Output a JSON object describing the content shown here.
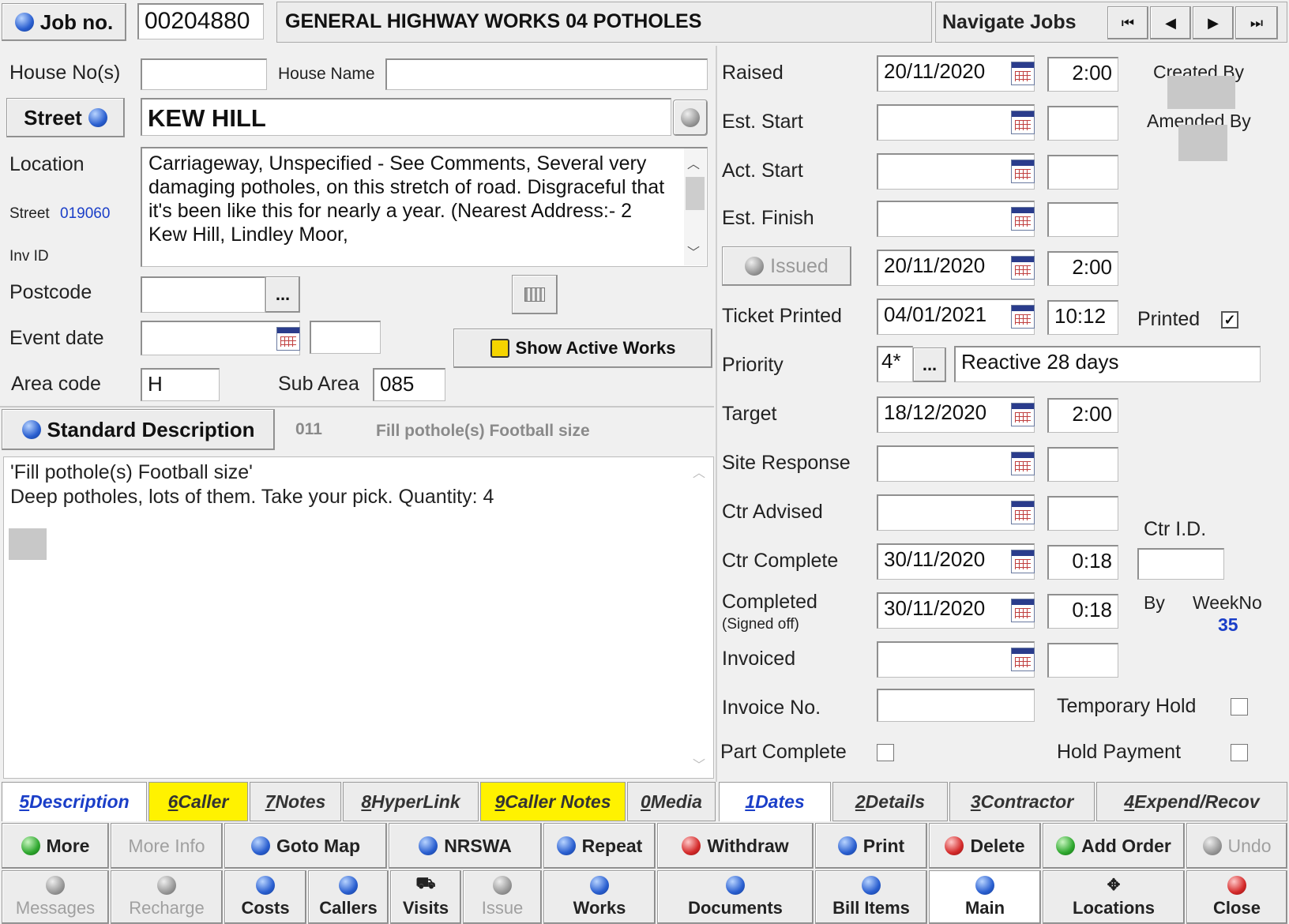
{
  "header": {
    "job_no_label": "Job no.",
    "job_no": "00204880",
    "job_title": "GENERAL HIGHWAY WORKS  04 POTHOLES",
    "navigate_label": "Navigate Jobs",
    "nav_first": "⏮",
    "nav_prev": "◀",
    "nav_next": "▶",
    "nav_last": "⏭"
  },
  "address": {
    "house_no_label": "House No(s)",
    "house_no": "",
    "house_name_label": "House Name",
    "house_name": "",
    "street_button": "Street",
    "street_value": "KEW HILL",
    "location_label": "Location",
    "location_text": "Carriageway, Unspecified - See Comments, Several very damaging potholes, on this stretch of road. Disgraceful that it's been like this for nearly a year. (Nearest Address:- 2 Kew Hill, Lindley Moor,",
    "street_code_label": "Street",
    "street_code": "019060",
    "inv_id_label": "Inv ID",
    "postcode_label": "Postcode",
    "postcode": "",
    "postcode_btn": "...",
    "event_date_label": "Event date",
    "event_date": "",
    "event_time": "",
    "show_active_works": "Show Active Works",
    "area_code_label": "Area code",
    "area_code": "H",
    "sub_area_label": "Sub Area",
    "sub_area": "085"
  },
  "description": {
    "std_desc_button": "Standard Description",
    "code": "011",
    "code_text": "Fill pothole(s) Football size",
    "line1": "'Fill pothole(s) Football size'",
    "line2": "Deep potholes, lots of them. Take your pick. Quantity: 4"
  },
  "dates": {
    "raised_label": "Raised",
    "raised_date": "20/11/2020",
    "raised_time": "2:00",
    "created_by_label": "Created By",
    "amended_by_label": "Amended By",
    "est_start_label": "Est. Start",
    "act_start_label": "Act. Start",
    "est_finish_label": "Est. Finish",
    "issued_button": "Issued",
    "issued_date": "20/11/2020",
    "issued_time": "2:00",
    "ticket_printed_label": "Ticket Printed",
    "ticket_date": "04/01/2021",
    "ticket_time": "10:12",
    "printed_label": "Printed",
    "printed_check": "✓",
    "priority_label": "Priority",
    "priority_code": "4*",
    "priority_btn": "...",
    "priority_text": "Reactive 28 days",
    "target_label": "Target",
    "target_date": "18/12/2020",
    "target_time": "2:00",
    "site_response_label": "Site Response",
    "ctr_advised_label": "Ctr Advised",
    "ctr_id_label": "Ctr I.D.",
    "ctr_complete_label": "Ctr Complete",
    "ctr_complete_date": "30/11/2020",
    "ctr_complete_time": "0:18",
    "completed_label": "Completed",
    "signed_off_label": "(Signed off)",
    "completed_date": "30/11/2020",
    "completed_time": "0:18",
    "by_label": "By",
    "weekno_label": "WeekNo",
    "weekno": "35",
    "invoiced_label": "Invoiced",
    "invoice_no_label": "Invoice No.",
    "temporary_hold_label": "Temporary Hold",
    "part_complete_label": "Part Complete",
    "hold_payment_label": "Hold Payment"
  },
  "tabs": [
    {
      "num": "5",
      "label": " Description"
    },
    {
      "num": "6",
      "label": " Caller"
    },
    {
      "num": "7",
      "label": " Notes"
    },
    {
      "num": "8",
      "label": " HyperLink"
    },
    {
      "num": "9",
      "label": " Caller Notes"
    },
    {
      "num": "0",
      "label": " Media"
    },
    {
      "num": "1",
      "label": " Dates"
    },
    {
      "num": "2",
      "label": " Details"
    },
    {
      "num": "3",
      "label": " Contractor"
    },
    {
      "num": "4",
      "label": " Expend/Recov"
    }
  ],
  "toolbar": {
    "more": "More",
    "more_info": "More Info",
    "goto_map": "Goto Map",
    "nrswa": "NRSWA",
    "repeat": "Repeat",
    "withdraw": "Withdraw",
    "print": "Print",
    "delete": "Delete",
    "add_order": "Add Order",
    "undo": "Undo"
  },
  "bottombar": {
    "messages": "Messages",
    "recharge": "Recharge",
    "costs": "Costs",
    "callers": "Callers",
    "visits": "Visits",
    "issue": "Issue",
    "works": "Works",
    "documents": "Documents",
    "bill_items": "Bill Items",
    "main": "Main",
    "locations": "Locations",
    "close": "Close"
  },
  "colors": {
    "tab_highlight": "#fff200",
    "link_blue": "#1a3ec8",
    "background": "#f0f0f0"
  }
}
